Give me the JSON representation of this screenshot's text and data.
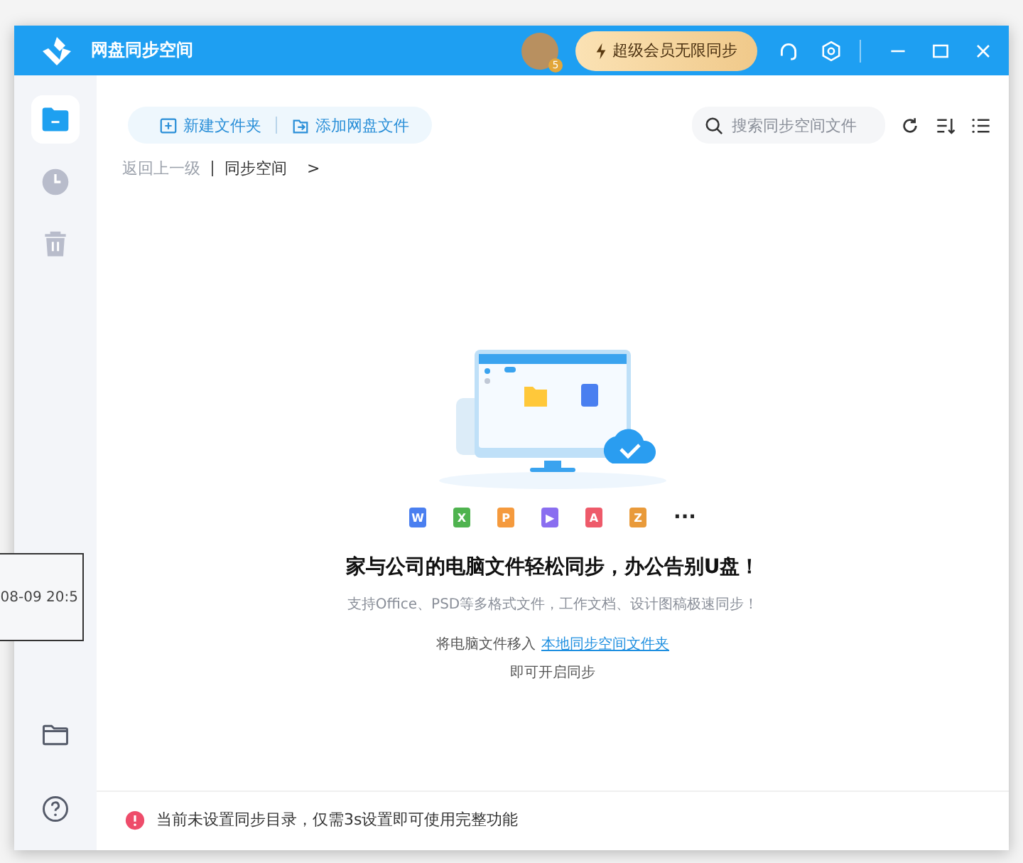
{
  "window": {
    "title": "网盘同步空间",
    "vip_button": "超级会员无限同步",
    "avatar_badge": "5"
  },
  "sidebar": {
    "items": [
      {
        "kind": "files",
        "selected": true
      },
      {
        "kind": "recent",
        "selected": false
      },
      {
        "kind": "trash",
        "selected": false
      }
    ],
    "bottom": [
      {
        "kind": "folder"
      },
      {
        "kind": "help"
      }
    ]
  },
  "toolbar": {
    "buttons": [
      {
        "kind": "new-folder",
        "label": "新建文件夹"
      },
      {
        "kind": "add",
        "label": "添加网盘文件"
      }
    ],
    "search": {
      "placeholder": "搜索同步空间文件"
    }
  },
  "breadcrumb": {
    "back": "返回上一级",
    "current": "同步空间",
    "arrow": ">"
  },
  "empty_state": {
    "file_types": [
      {
        "letter": "W",
        "color": "#4a7ff0"
      },
      {
        "letter": "X",
        "color": "#4fb34f"
      },
      {
        "letter": "P",
        "color": "#f59a3d"
      },
      {
        "letter": "▶",
        "color": "#8a6ef0"
      },
      {
        "letter": "A",
        "color": "#ee5a6a"
      },
      {
        "letter": "Z",
        "color": "#e99a3a"
      }
    ],
    "more": "···",
    "title": "家与公司的电脑文件轻松同步，办公告别U盘！",
    "subtitle": "支持Office、PSD等多格式文件，工作文档、设计图稿极速同步！",
    "hint": "将电脑文件移入",
    "link": "本地同步空间文件夹",
    "hint2": "即可开启同步"
  },
  "notice": {
    "text": "当前未设置同步目录，仅需3s设置即可使用完整功能"
  },
  "tooltip": {
    "text": "08-09 20:5"
  }
}
